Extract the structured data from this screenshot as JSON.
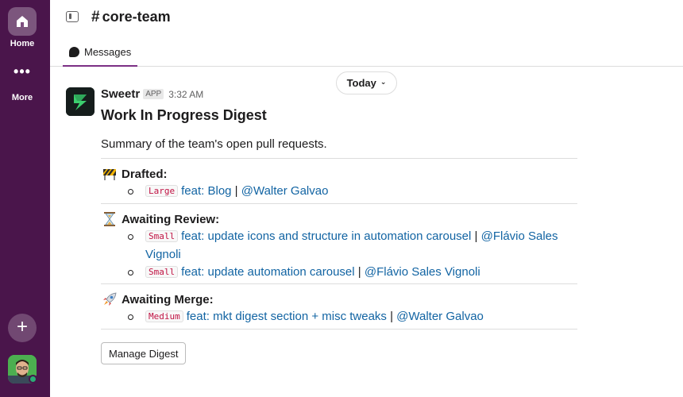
{
  "rail": {
    "home_label": "Home",
    "more_label": "More",
    "more_dots": "•••",
    "add_symbol": "+"
  },
  "header": {
    "channel_hash": "#",
    "channel_name": "core-team",
    "tab_messages": "Messages"
  },
  "date_pill": {
    "label": "Today",
    "chevron": "⌄"
  },
  "message": {
    "sender": "Sweetr",
    "badge": "APP",
    "time": "3:32 AM",
    "title": "Work In Progress Digest",
    "summary": "Summary of the team's open pull requests.",
    "sections": [
      {
        "emoji": "construction-icon",
        "title": "Drafted:",
        "items": [
          {
            "size": "Large",
            "text": "feat: Blog",
            "sep": " | ",
            "author": "@Walter Galvao"
          }
        ]
      },
      {
        "emoji": "hourglass-icon",
        "title": "Awaiting Review:",
        "items": [
          {
            "size": "Small",
            "text": "feat: update icons and structure in automation carousel",
            "sep": " | ",
            "author": "@Flávio Sales Vignoli"
          },
          {
            "size": "Small",
            "text": "feat: update automation carousel",
            "sep": " | ",
            "author": "@Flávio Sales Vignoli"
          }
        ]
      },
      {
        "emoji": "rocket-icon",
        "title": "Awaiting Merge:",
        "items": [
          {
            "size": "Medium",
            "text": "feat: mkt digest section + misc tweaks",
            "sep": " | ",
            "author": "@Walter Galvao"
          }
        ]
      }
    ],
    "button": "Manage Digest"
  },
  "colors": {
    "rail_bg": "#4a154b",
    "link": "#1264a3",
    "code_text": "#c01343",
    "tab_underline": "#7c3085"
  }
}
